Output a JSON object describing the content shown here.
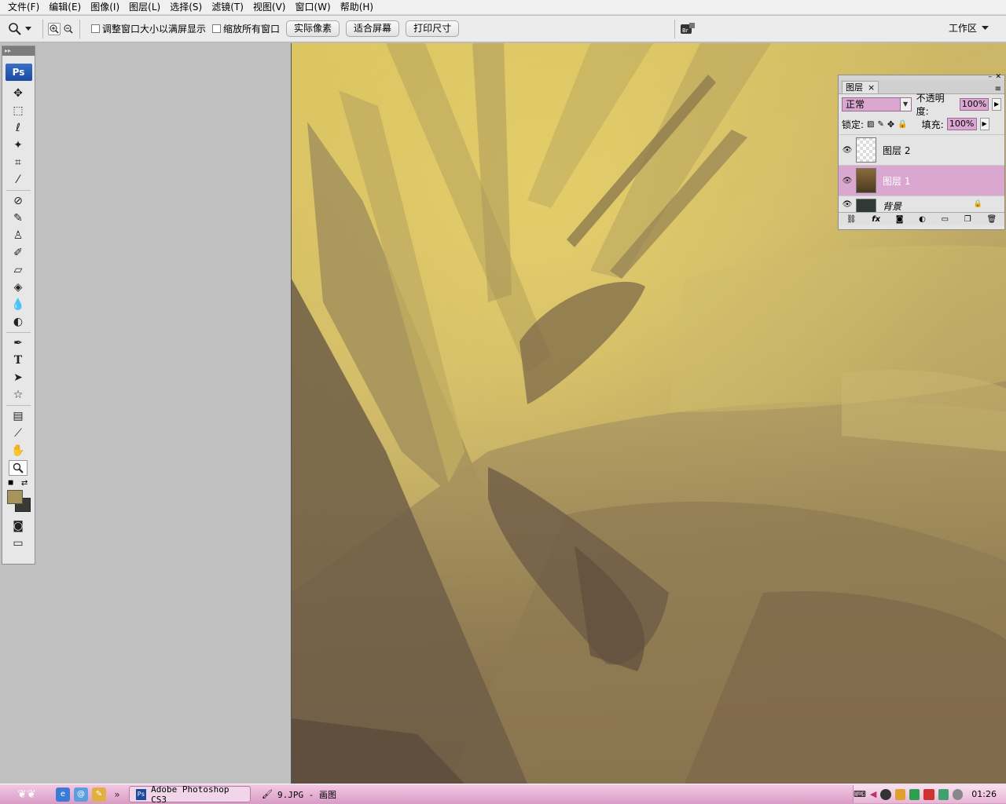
{
  "menubar": {
    "items": [
      "文件(F)",
      "编辑(E)",
      "图像(I)",
      "图层(L)",
      "选择(S)",
      "滤镜(T)",
      "视图(V)",
      "窗口(W)",
      "帮助(H)"
    ]
  },
  "options": {
    "checkbox_resize": "调整窗口大小以满屏显示",
    "checkbox_zoom_all": "缩放所有窗口",
    "btn_actual": "实际像素",
    "btn_fit": "适合屏幕",
    "btn_print": "打印尺寸",
    "workspace": "工作区"
  },
  "toolbox": {
    "logo": "Ps",
    "tools": [
      "move-icon",
      "marquee-icon",
      "lasso-icon",
      "magic-wand-icon",
      "crop-icon",
      "slice-icon",
      "healing-brush-icon",
      "brush-icon",
      "clone-stamp-icon",
      "history-brush-icon",
      "eraser-icon",
      "paint-bucket-icon",
      "blur-icon",
      "dodge-icon",
      "pen-icon",
      "type-icon",
      "path-select-icon",
      "shape-icon",
      "notes-icon",
      "eyedropper-icon",
      "hand-icon",
      "zoom-icon"
    ],
    "fg_color": "#a8935a",
    "bg_color": "#3a3a34"
  },
  "layers": {
    "tab": "图层",
    "blend_mode": "正常",
    "opacity_label": "不透明度:",
    "opacity": "100%",
    "lock_label": "锁定:",
    "fill_label": "填充:",
    "fill": "100%",
    "items": [
      {
        "name": "图层 2"
      },
      {
        "name": "图层 1"
      },
      {
        "name": "背景"
      }
    ]
  },
  "taskbar": {
    "tasks": [
      "Adobe Photoshop CS3",
      "9.JPG - 画图"
    ],
    "clock": "01:26"
  },
  "colors": {
    "accent": "#d9a7cf",
    "canvas_light": "#d9c46a",
    "canvas_dark": "#7d6a4e"
  }
}
